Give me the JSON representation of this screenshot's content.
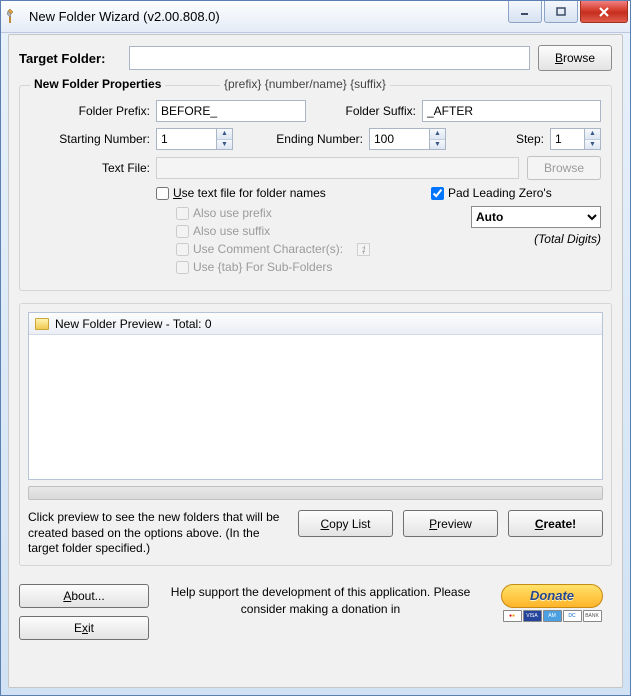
{
  "window": {
    "title": "New Folder Wizard  (v2.00.808.0)"
  },
  "target": {
    "label": "Target Folder:",
    "value": "",
    "browse": "Browse"
  },
  "group": {
    "title": "New Folder Properties",
    "pattern": "{prefix} {number/name} {suffix}",
    "prefix_label": "Folder Prefix:",
    "prefix_value": "BEFORE_",
    "suffix_label": "Folder Suffix:",
    "suffix_value": "_AFTER",
    "start_label": "Starting Number:",
    "start_value": "1",
    "end_label": "Ending Number:",
    "end_value": "100",
    "step_label": "Step:",
    "step_value": "1",
    "textfile_label": "Text File:",
    "textfile_value": "",
    "textfile_browse": "Browse",
    "use_textfile": "Use text file for folder names",
    "also_prefix": "Also use prefix",
    "also_suffix": "Also use suffix",
    "use_comment": "Use Comment Character(s):",
    "comment_value": "#",
    "use_tab": "Use {tab} For Sub-Folders",
    "pad_zeros": "Pad Leading Zero's",
    "pad_mode": "Auto",
    "total_digits": "(Total Digits)"
  },
  "preview": {
    "header": "New Folder Preview - Total: 0"
  },
  "actions": {
    "hint": "Click preview to see the new folders that will be created based on the options above. (In the target folder specified.)",
    "copy": "Copy List",
    "preview": "Preview",
    "create": "Create!"
  },
  "footer": {
    "about": "About...",
    "exit": "Exit",
    "support": "Help support the development of this application. Please consider making a donation in",
    "donate": "Donate"
  },
  "checks": {
    "use_textfile": false,
    "pad_zeros": true
  }
}
